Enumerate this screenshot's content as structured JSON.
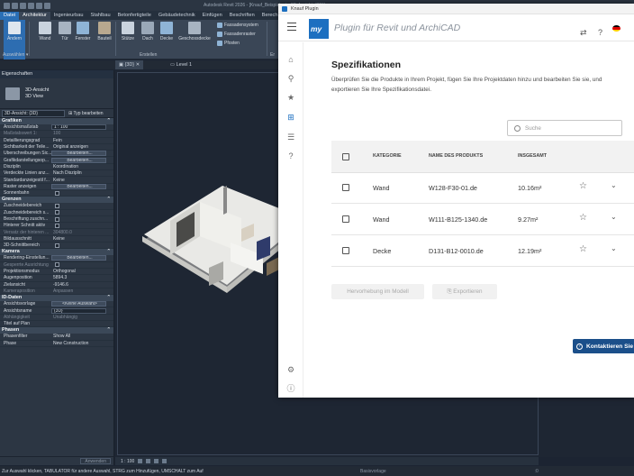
{
  "revit": {
    "title": "Autodesk Revit 2026 - [Knauf_Beispiel.rvt - 3D-Ansicht: {3D}]",
    "file_tab": "Datei",
    "ribbon_tabs": [
      "Architektur",
      "Ingenieurbau",
      "Stahlbau",
      "Betonfertigteile",
      "Gebäudetechnik",
      "Einfügen",
      "Beschriften",
      "Berech"
    ],
    "tools": {
      "modify": "Ändern",
      "wall": "Wand",
      "door": "Tür",
      "window": "Fenster",
      "component": "Bauteil",
      "column": "Stütze",
      "roof": "Dach",
      "ceiling": "Decke",
      "floor": "Geschossdecke",
      "curtain_system": "Fassadensystem",
      "curtain_grid": "Fassadenraster",
      "mullion": "Pfosten",
      "select_panel": "Auswählen",
      "build_panel": "Erstellen",
      "extra_panel": "Er"
    },
    "view_tabs": [
      "{3D}",
      "Level 1"
    ],
    "properties": {
      "header": "Eigenschaften",
      "type_line1": "3D-Ansicht",
      "type_line2": "3D View",
      "filter": "3D-Ansicht: {3D}",
      "edit_type": "Typ bearbeiten",
      "apply": "Anwenden",
      "sections": [
        {
          "name": "Grafiken",
          "rows": [
            [
              "Ansichtsmaßstab",
              "1 : 100",
              "box"
            ],
            [
              "Maßstabswert 1:",
              "100",
              "dim"
            ],
            [
              "Detaillierungsgrad",
              "Fein",
              ""
            ],
            [
              "Sichtbarkeit der Teile...",
              "Original anzeigen",
              ""
            ],
            [
              "Überschreibungen Sic...",
              "Bearbeiten...",
              "btn"
            ],
            [
              "Grafikdarstellungsop...",
              "Bearbeiten...",
              "btn"
            ],
            [
              "Disziplin",
              "Koordination",
              ""
            ],
            [
              "Verdeckte Linien anz...",
              "Nach Disziplin",
              ""
            ],
            [
              "Standardanzeigestil f...",
              "Keine",
              ""
            ],
            [
              "Raster anzeigen",
              "Bearbeiten...",
              "btn"
            ],
            [
              "Sonnenbahn",
              "",
              "cb"
            ]
          ]
        },
        {
          "name": "Grenzen",
          "rows": [
            [
              "Zuschneidebereich",
              "",
              "cb"
            ],
            [
              "Zuschneidebereich s...",
              "",
              "cb"
            ],
            [
              "Beschriftung zuschn...",
              "",
              "cb"
            ],
            [
              "Hinterer Schnitt aktiv",
              "",
              "cb"
            ],
            [
              "Versatz der hinteren ...",
              "304800.0",
              "dim"
            ],
            [
              "Bildausschnitt",
              "Keine",
              ""
            ],
            [
              "3D-Schnittbereich",
              "",
              "cb"
            ]
          ]
        },
        {
          "name": "Kamera",
          "rows": [
            [
              "Rendering-Einstellun...",
              "Bearbeiten...",
              "btn"
            ],
            [
              "Gesperrte Ausrichtung",
              "",
              "dimcb"
            ],
            [
              "Projektionsmodus",
              "Orthogonal",
              ""
            ],
            [
              "Augenposition",
              "5894.3",
              ""
            ],
            [
              "Zielansicht",
              "-9146.6",
              ""
            ],
            [
              "Kameraposition",
              "Anpassen",
              "dim"
            ]
          ]
        },
        {
          "name": "ID-Daten",
          "rows": [
            [
              "Ansichtsvorlage",
              "<Keine Auswahl>",
              "btn"
            ],
            [
              "Ansichtsname",
              "{3D}",
              "box"
            ],
            [
              "Abhängigkeit",
              "Unabhängig",
              "dim"
            ],
            [
              "Titel auf Plan",
              "",
              ""
            ]
          ]
        },
        {
          "name": "Phasen",
          "rows": [
            [
              "Phasenfilter",
              "Show All",
              ""
            ],
            [
              "Phase",
              "New Construction",
              ""
            ]
          ]
        }
      ]
    },
    "view_scale": "1 : 100",
    "status_message": "Zur Auswahl klicken, TABULATOR für andere Auswahl, STRG zum Hinzufügen, UMSCHALT zum Auf",
    "status_mid": "Basisvorlage",
    "status_zero": ":0"
  },
  "plugin": {
    "window_title": "Knauf Plugin",
    "logo_text": "my",
    "app_title": "Plugin für Revit und ArchiCAD",
    "page_title": "Spezifikationen",
    "description": "Überprüfen Sie die Produkte in Ihrem Projekt, fügen Sie Ihre Projektdaten hinzu und bearbeiten Sie sie, und exportieren Sie Ihre Spezifikationsdatei.",
    "search_placeholder": "Suche",
    "columns": [
      "KATEGORIE",
      "NAME DES PRODUKTS",
      "INSGESAMT"
    ],
    "rows": [
      {
        "category": "Wand",
        "product": "W128-F30-01.de",
        "total": "10.16m²"
      },
      {
        "category": "Wand",
        "product": "W111-B125-1340.de",
        "total": "9.27m²"
      },
      {
        "category": "Decke",
        "product": "D131-B12-0010.de",
        "total": "12.19m²"
      }
    ],
    "highlight_button": "Hervorhebung im Modell",
    "export_button": "Exportieren",
    "contact_button": "Kontaktieren Sie",
    "colors": {
      "brand": "#1c6fc0",
      "contact": "#1b4f8a"
    }
  }
}
